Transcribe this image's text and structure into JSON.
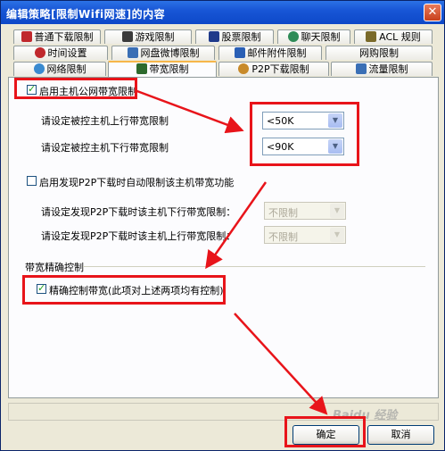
{
  "window": {
    "title": "编辑策略[限制Wifi网速]的内容",
    "close_glyph": "✕"
  },
  "tabs_row1": [
    {
      "label": "普通下载限制",
      "icon": "download-icon",
      "color": "#c0282d"
    },
    {
      "label": "游戏限制",
      "icon": "game-icon",
      "color": "#3a3a3a"
    },
    {
      "label": "股票限制",
      "icon": "stock-icon",
      "color": "#1f3a8a"
    },
    {
      "label": "聊天限制",
      "icon": "chat-icon",
      "color": "#2e8b57"
    },
    {
      "label": "ACL 规则",
      "icon": "key-icon",
      "color": "#7a6a2a"
    }
  ],
  "tabs_row2": [
    {
      "label": "时间设置",
      "icon": "clock-icon",
      "color": "#c0282d"
    },
    {
      "label": "网盘微博限制",
      "icon": "cloud-icon",
      "color": "#3a6fb5"
    },
    {
      "label": "邮件附件限制",
      "icon": "mail-icon",
      "color": "#2a5fb5"
    },
    {
      "label": "网购限制",
      "icon": "",
      "color": ""
    }
  ],
  "tabs_row3": [
    {
      "label": "网络限制",
      "icon": "globe-icon",
      "color": "#3a8ad0"
    },
    {
      "label": "带宽限制",
      "icon": "bandwidth-icon",
      "color": "#2d6a2d"
    },
    {
      "label": "P2P下载限制",
      "icon": "p2p-icon",
      "color": "#c88a2a"
    },
    {
      "label": "流量限制",
      "icon": "chart-icon",
      "color": "#3a6fb5"
    }
  ],
  "bandwidth": {
    "enable_label": "启用主机公网带宽限制",
    "enable_checked": true,
    "up_label": "请设定被控主机上行带宽限制",
    "up_value": "<50K",
    "down_label": "请设定被控主机下行带宽限制",
    "down_value": "<90K"
  },
  "p2p": {
    "enable_label": "启用发现P2P下载时自动限制该主机带宽功能",
    "enable_checked": false,
    "down_label": "请设定发现P2P下载时该主机下行带宽限制：",
    "down_value": "不限制",
    "up_label": "请设定发现P2P下载时该主机上行带宽限制：",
    "up_value": "不限制"
  },
  "precise": {
    "group_label": "带宽精确控制",
    "check_label": "精确控制带宽(此项对上述两项均有控制)",
    "checked": true
  },
  "buttons": {
    "ok": "确定",
    "cancel": "取消"
  },
  "watermark": "Baidu 经验",
  "colors": {
    "annotation": "#e8141a",
    "title_bar": "#0d48c8"
  }
}
